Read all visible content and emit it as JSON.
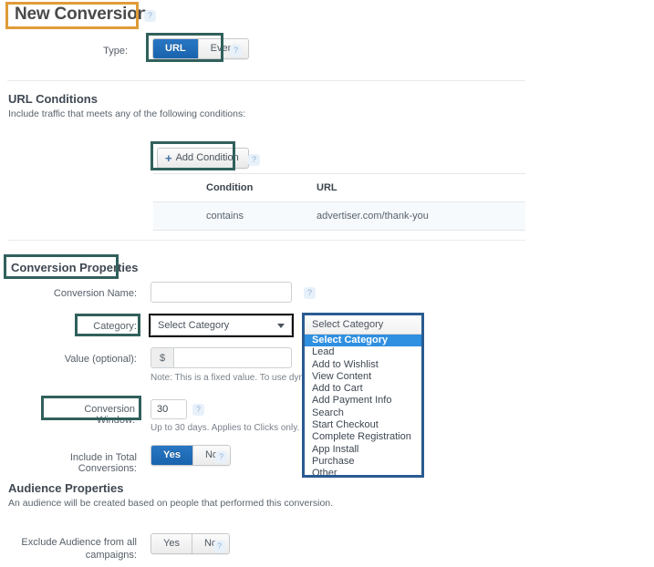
{
  "page": {
    "title": "New Conversion"
  },
  "icons": {
    "help": "?",
    "plus": "+"
  },
  "type_row": {
    "label": "Type:",
    "options": [
      "URL",
      "Event"
    ],
    "selected": "URL"
  },
  "url_conditions": {
    "heading": "URL Conditions",
    "subtext": "Include traffic that meets any of the following conditions:",
    "add_button": "Add Condition",
    "columns": [
      "Condition",
      "URL"
    ],
    "rows": [
      {
        "condition": "contains",
        "url": "advertiser.com/thank-you"
      }
    ]
  },
  "conversion_properties": {
    "heading": "Conversion Properties",
    "conversion_name": {
      "label": "Conversion Name:",
      "value": "",
      "placeholder": ""
    },
    "category": {
      "label": "Category:",
      "selected": "Select Category"
    },
    "value": {
      "label": "Value (optional):",
      "currency_prefix": "$",
      "value": "",
      "note": "Note: This is a fixed value. To use dynamic                               under the event code."
    },
    "conversion_window": {
      "label": "Conversion Window:",
      "value": "30",
      "note": "Up to 30 days. Applies to Clicks only."
    },
    "include_in_total": {
      "label": "Include in Total Conversions:",
      "options": [
        "Yes",
        "No"
      ],
      "selected": "Yes"
    }
  },
  "category_dropdown": {
    "header": "Select Category",
    "options": [
      "Select Category",
      "Lead",
      "Add to Wishlist",
      "View Content",
      "Add to Cart",
      "Add Payment Info",
      "Search",
      "Start Checkout",
      "Complete Registration",
      "App Install",
      "Purchase",
      "Other"
    ],
    "selected": "Select Category"
  },
  "audience_properties": {
    "heading": "Audience Properties",
    "subtext": "An audience will be created based on people that performed this conversion.",
    "exclude_audience": {
      "label_line1": "Exclude Audience from all",
      "label_line2": "campaigns:",
      "options": [
        "Yes",
        "No"
      ],
      "selected": ""
    }
  },
  "colors": {
    "highlight_teal": "#31605c",
    "highlight_orange": "#e09b38",
    "highlight_navy": "#1c3f66",
    "toggle_active_blue": "#1a63ad",
    "dropdown_selected_blue": "#2f8fe0"
  }
}
